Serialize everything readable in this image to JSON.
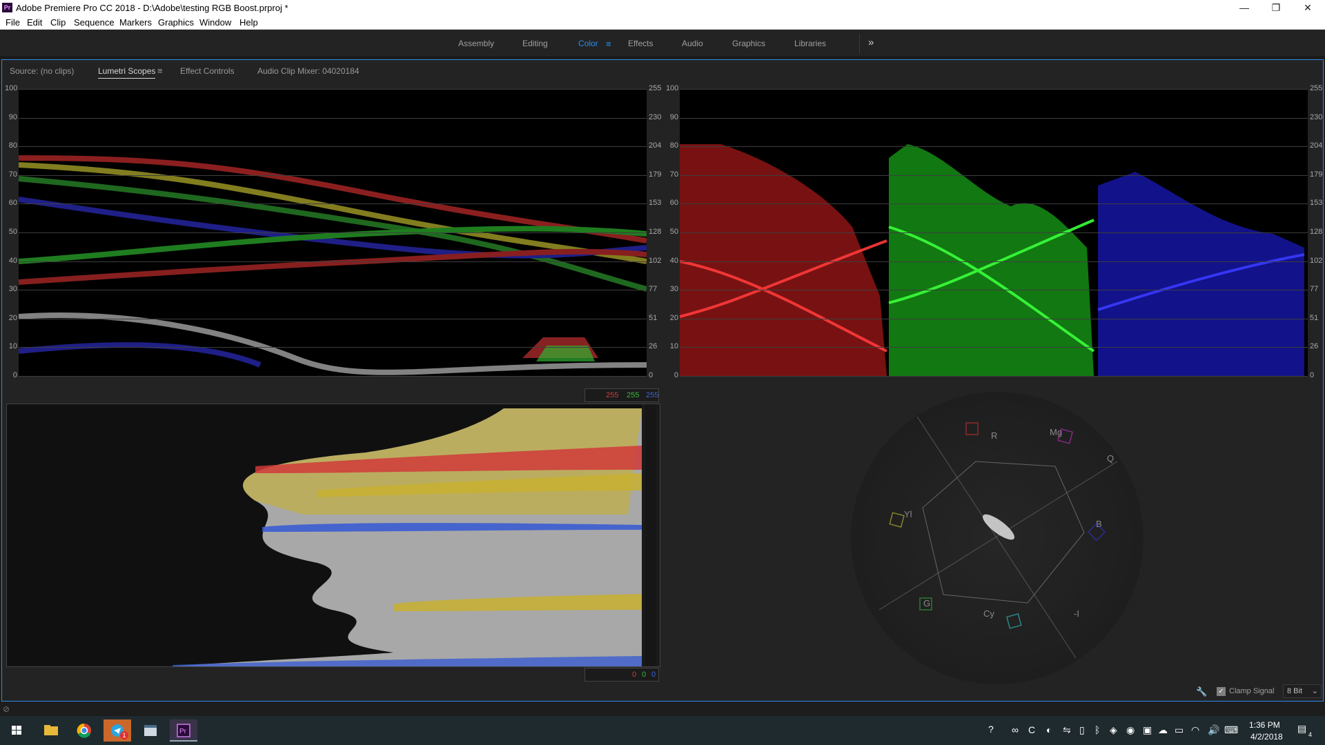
{
  "window": {
    "title": "Adobe Premiere Pro CC 2018 - D:\\Adobe\\testing RGB Boost.prproj *",
    "logo": "Pr",
    "minimize": "—",
    "restore": "❐",
    "close": "✕"
  },
  "menu": [
    "File",
    "Edit",
    "Clip",
    "Sequence",
    "Markers",
    "Graphics",
    "Window",
    "Help"
  ],
  "workspaces": {
    "items": [
      "Assembly",
      "Editing",
      "Color",
      "Effects",
      "Audio",
      "Graphics",
      "Libraries"
    ],
    "active": "Color",
    "more": "»",
    "menu_icon": "≡"
  },
  "panel": {
    "tabs": [
      "Source: (no clips)",
      "Lumetri Scopes",
      "Effect Controls",
      "Audio Clip Mixer: 04020184"
    ],
    "active": "Lumetri Scopes",
    "tab_menu": "≡"
  },
  "scales": {
    "ire_left": [
      "100",
      "90",
      "80",
      "70",
      "60",
      "50",
      "40",
      "30",
      "20",
      "10",
      "0"
    ],
    "byte_right": [
      "255",
      "230",
      "204",
      "179",
      "153",
      "128",
      "102",
      "77",
      "51",
      "26",
      "0"
    ]
  },
  "histogram": {
    "top_values": [
      "255",
      "255",
      "255"
    ],
    "bottom_values": [
      "0",
      "0",
      "0"
    ],
    "value_colors": [
      "#d03a3a",
      "#3ab83a",
      "#3a62d6"
    ]
  },
  "vectorscope": {
    "labels": [
      "R",
      "Mg",
      "Q",
      "B",
      "-I",
      "Cy",
      "G",
      "Yl"
    ],
    "colors": [
      "#c03030",
      "#b030b0",
      "#7a7aa0",
      "#3030c0",
      "#7a7aa0",
      "#30b0b0",
      "#30a030",
      "#b0b030"
    ]
  },
  "bottom_controls": {
    "clamp_label": "Clamp Signal",
    "clamp_checked": true,
    "bit_depth": "8 Bit",
    "wrench_icon": "wrench-icon"
  },
  "taskbar": {
    "time": "1:36 PM",
    "date": "4/2/2018",
    "notification_count": "4",
    "telegram_badge": "1"
  }
}
